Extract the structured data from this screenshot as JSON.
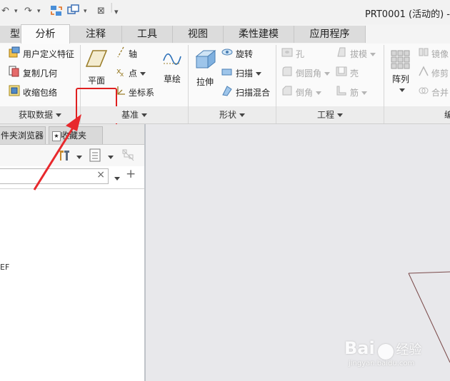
{
  "window": {
    "title": "PRT0001 (活动的) -"
  },
  "quick_access": {
    "close_glyph": "⊠",
    "more_glyph": "▾"
  },
  "tabs": [
    "型",
    "分析",
    "注释",
    "工具",
    "视图",
    "柔性建模",
    "应用程序"
  ],
  "ribbon": {
    "get_data": {
      "items": [
        "用户定义特征",
        "复制几何",
        "收缩包络"
      ],
      "footer": "获取数据"
    },
    "datum": {
      "plane": "平面",
      "axis": "轴",
      "point": "点",
      "csys": "坐标系",
      "sketch": "草绘",
      "footer": "基准"
    },
    "shapes": {
      "extrude": "拉伸",
      "revolve": "旋转",
      "sweep": "扫描",
      "swept_blend": "扫描混合",
      "footer": "形状"
    },
    "engineering": {
      "hole": "孔",
      "draft": "拔模",
      "round": "倒圆角",
      "shell": "壳",
      "chamfer": "倒角",
      "rib": "筋",
      "footer": "工程"
    },
    "editing": {
      "pattern": "阵列",
      "mirror": "镜像",
      "trim": "修剪",
      "merge": "合并",
      "footer": "编"
    }
  },
  "left_panel": {
    "tabs": [
      "件夹浏览器",
      "收藏夹"
    ],
    "filter_clear": "×",
    "add_glyph": "+",
    "tree_text": "EF"
  },
  "watermark": {
    "brand": "Bai",
    "sub": "经验",
    "url": "jingyan.baidu.com"
  },
  "colors": {
    "highlight": "#e02020",
    "arrow": "#e8282c",
    "tab_active": "#fbfbfb"
  }
}
